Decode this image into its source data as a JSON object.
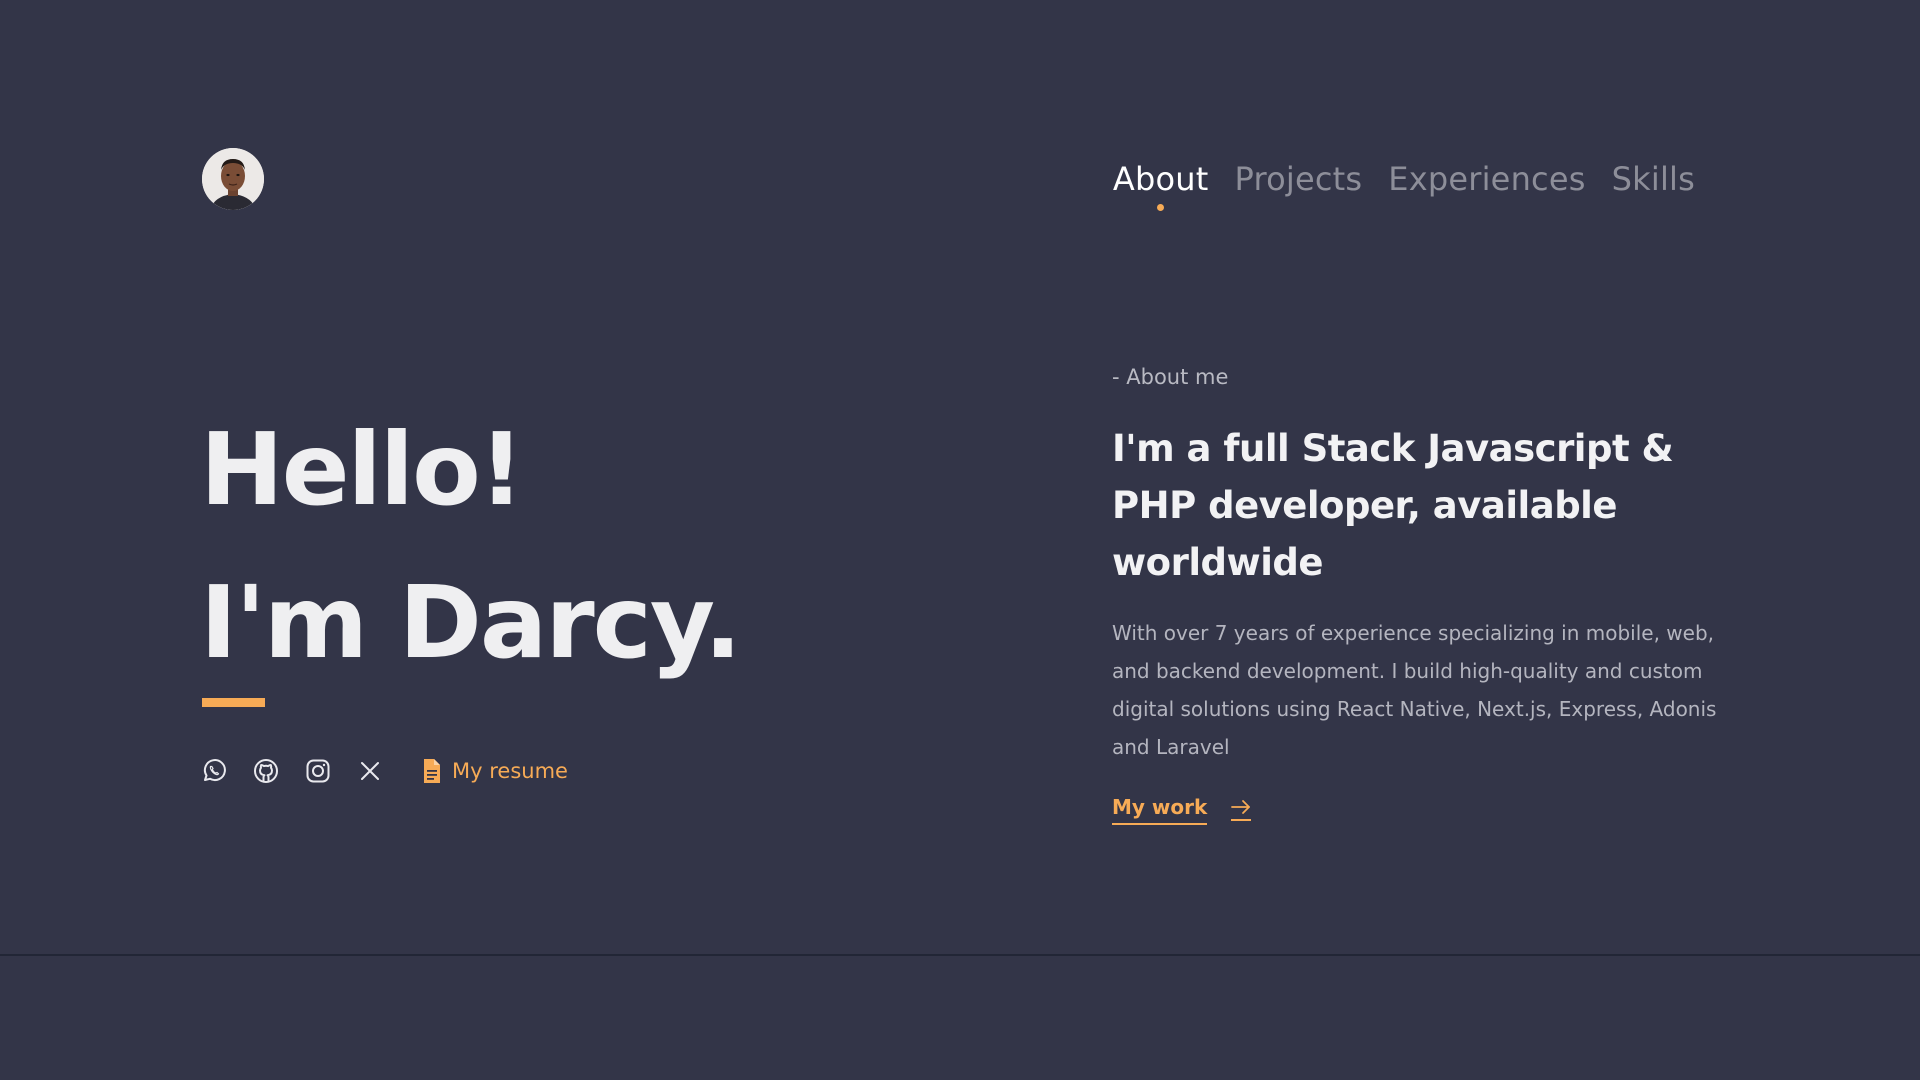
{
  "header": {
    "avatar_alt": "Profile photo",
    "nav": [
      {
        "label": "About",
        "active": true
      },
      {
        "label": "Projects",
        "active": false
      },
      {
        "label": "Experiences",
        "active": false
      },
      {
        "label": "Skills",
        "active": false
      }
    ]
  },
  "hero": {
    "greeting": "Hello!",
    "name_line": "I'm Darcy.",
    "socials": [
      {
        "icon": "whatsapp-icon"
      },
      {
        "icon": "github-icon"
      },
      {
        "icon": "instagram-icon"
      },
      {
        "icon": "x-icon"
      }
    ],
    "resume_label": "My resume"
  },
  "about": {
    "label": "- About me",
    "headline": "I'm a full Stack Javascript & PHP developer, available worldwide",
    "bio": "With over 7 years of experience specializing in mobile, web, and backend development. I build high-quality and custom digital solutions using React Native, Next.js, Express, Adonis and Laravel",
    "cta_label": "My work"
  },
  "colors": {
    "background": "#333548",
    "accent": "#f7ab56",
    "text": "#f0f0f2",
    "muted": "#8d8e99"
  }
}
